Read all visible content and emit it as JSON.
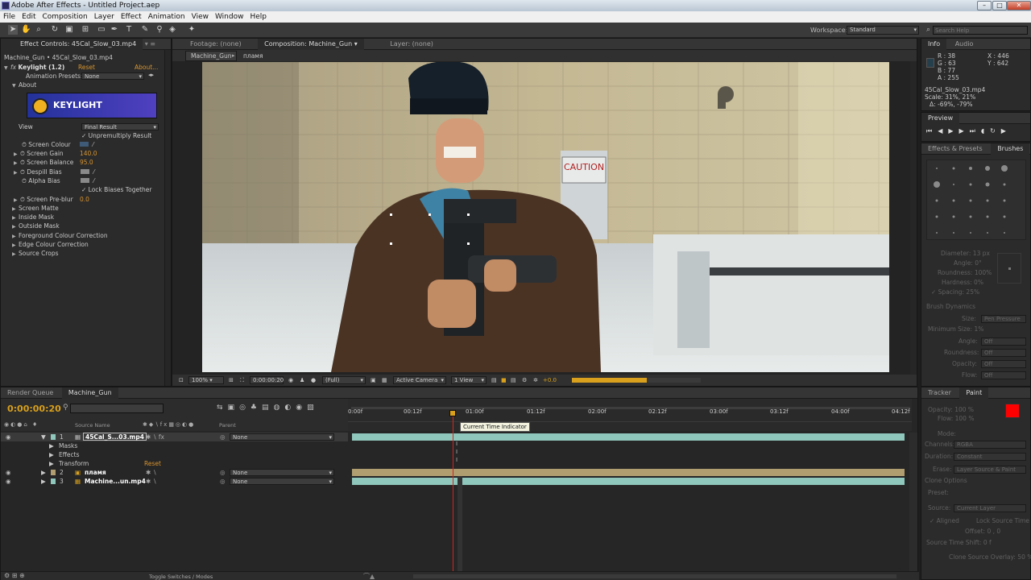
{
  "window": {
    "title": "Adobe After Effects - Untitled Project.aep"
  },
  "menu": [
    "File",
    "Edit",
    "Composition",
    "Layer",
    "Effect",
    "Animation",
    "View",
    "Window",
    "Help"
  ],
  "toolbar": {
    "workspace_label": "Workspace:",
    "workspace_value": "Standard",
    "search_placeholder": "Search Help"
  },
  "effect_controls": {
    "tab": "Effect Controls: 45Cal_Slow_03.mp4",
    "breadcrumb": "Machine_Gun • 45Cal_Slow_03.mp4",
    "effect_name": "Keylight (1.2)",
    "reset": "Reset",
    "about": "About...",
    "animation_presets_label": "Animation Presets:",
    "animation_presets_value": "None",
    "about_section": "About",
    "logo_text": "KEYLIGHT",
    "view_label": "View",
    "view_value": "Final Result",
    "unpremultiply": "Unpremultiply Result",
    "screen_colour": "Screen Colour",
    "screen_gain": "Screen Gain",
    "screen_gain_value": "140.0",
    "screen_balance": "Screen Balance",
    "screen_balance_value": "95.0",
    "despill_bias": "Despill Bias",
    "alpha_bias": "Alpha Bias",
    "lock_biases": "Lock Biases Together",
    "screen_preblur": "Screen Pre-blur",
    "screen_preblur_value": "0.0",
    "sections": [
      "Screen Matte",
      "Inside Mask",
      "Outside Mask",
      "Foreground Colour Correction",
      "Edge Colour Correction",
      "Source Crops"
    ]
  },
  "viewer": {
    "tabs": [
      "Footage: (none)",
      "Composition: Machine_Gun",
      "Layer: (none)"
    ],
    "sub_tabs": [
      "Machine_Gun",
      "пламя"
    ],
    "caution_sign": "CAUTION",
    "zoom": "100%",
    "timecode": "0:00:00:20",
    "resolution": "(Full)",
    "camera": "Active Camera",
    "view": "1 View",
    "exposure": "+0.0",
    "render_progress": 0.58
  },
  "info_panel": {
    "tabs": [
      "Info",
      "Audio"
    ],
    "r": "R : 38",
    "g": "G : 63",
    "b": "B : 77",
    "a": "A : 255",
    "x": "X : 446",
    "y": "Y : 642",
    "file": "45Cal_Slow_03.mp4",
    "scale": "Scale: 31%, 21%",
    "delta": "Δ: -69%, -79%"
  },
  "preview_panel": {
    "tab": "Preview"
  },
  "brushes_panel": {
    "tabs": [
      "Effects & Presets",
      "Brushes"
    ],
    "diameter": "Diameter: 13 px",
    "angle": "Angle: 0°",
    "roundness": "Roundness: 100%",
    "hardness": "Hardness: 0%",
    "spacing": "Spacing: 25%",
    "dynamics": "Brush Dynamics",
    "size_label": "Size:",
    "size_value": "Pen Pressure",
    "min_size": "Minimum Size: 1%",
    "angle2": "Angle:",
    "angle2_value": "Off",
    "roundness2": "Roundness:",
    "roundness2_value": "Off",
    "opacity": "Opacity:",
    "opacity_value": "Off",
    "flow": "Flow:",
    "flow_value": "Off"
  },
  "paint_panel": {
    "tabs": [
      "Tracker",
      "Paint"
    ],
    "opacity": "Opacity: 100 %",
    "flow": "Flow: 100 %",
    "mode": "Mode:",
    "channels": "Channels:",
    "channels_value": "RGBA",
    "duration": "Duration:",
    "duration_value": "Constant",
    "erase": "Erase:",
    "erase_value": "Layer Source & Paint",
    "clone_options": "Clone Options",
    "preset": "Preset:",
    "source": "Source:",
    "source_value": "Current Layer",
    "aligned": "Aligned",
    "lock_source_time": "Lock Source Time",
    "offset": "Offset: 0 , 0",
    "source_time_shift": "Source Time Shift: 0 f",
    "clone_overlay": "Clone Source Overlay: 50 %",
    "fg_color": "#ff0000"
  },
  "timeline": {
    "tabs": [
      "Render Queue",
      "Machine_Gun"
    ],
    "timecode": "0:00:00:20",
    "col_source": "Source Name",
    "col_parent": "Parent",
    "ruler": [
      "0:00f",
      "00:12f",
      "01:00f",
      "01:12f",
      "02:00f",
      "02:12f",
      "03:00f",
      "03:12f",
      "04:00f",
      "04:12f"
    ],
    "tooltip": "Current Time Indicator",
    "layers": [
      {
        "num": "1",
        "name": "45Cal_S...03.mp4",
        "parent": "None"
      },
      {
        "num": "2",
        "name": "пламя",
        "parent": "None"
      },
      {
        "num": "3",
        "name": "Machine...un.mp4",
        "parent": "None"
      }
    ],
    "sub_props": [
      "Masks",
      "Effects",
      "Transform"
    ],
    "transform_reset": "Reset",
    "toggle_label": "Toggle Switches / Modes",
    "colors": {
      "accent": "#d8a01c",
      "playhead": "#d2271f",
      "track_teal": "#8fc7bc",
      "track_tan": "#b09d70"
    }
  }
}
